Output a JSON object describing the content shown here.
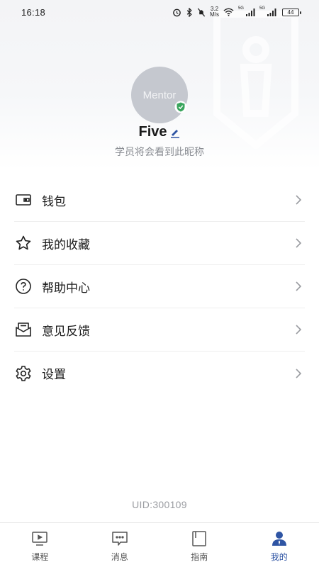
{
  "status_bar": {
    "time": "16:18",
    "net_speed_value": "3.2",
    "net_speed_unit": "M/s",
    "sim1_label": "5G",
    "sim2_label": "5G",
    "battery": "44"
  },
  "profile": {
    "avatar_text": "Mentor",
    "name": "Five",
    "subtitle": "学员将会看到此昵称"
  },
  "menu": {
    "items": [
      {
        "label": "钱包",
        "icon": "wallet-icon"
      },
      {
        "label": "我的收藏",
        "icon": "star-icon"
      },
      {
        "label": "帮助中心",
        "icon": "help-icon"
      },
      {
        "label": "意见反馈",
        "icon": "feedback-mail-icon"
      },
      {
        "label": "设置",
        "icon": "gear-icon"
      }
    ]
  },
  "uid": "UID:300109",
  "tab_bar": {
    "tabs": [
      {
        "label": "课程",
        "icon": "course-video-icon",
        "active": false
      },
      {
        "label": "消息",
        "icon": "message-icon",
        "active": false
      },
      {
        "label": "指南",
        "icon": "guide-book-icon",
        "active": false
      },
      {
        "label": "我的",
        "icon": "profile-person-icon",
        "active": true
      }
    ]
  },
  "colors": {
    "accent": "#2f55a4",
    "verified_green": "#3aa55d",
    "avatar_bg": "#c5c8cf"
  }
}
